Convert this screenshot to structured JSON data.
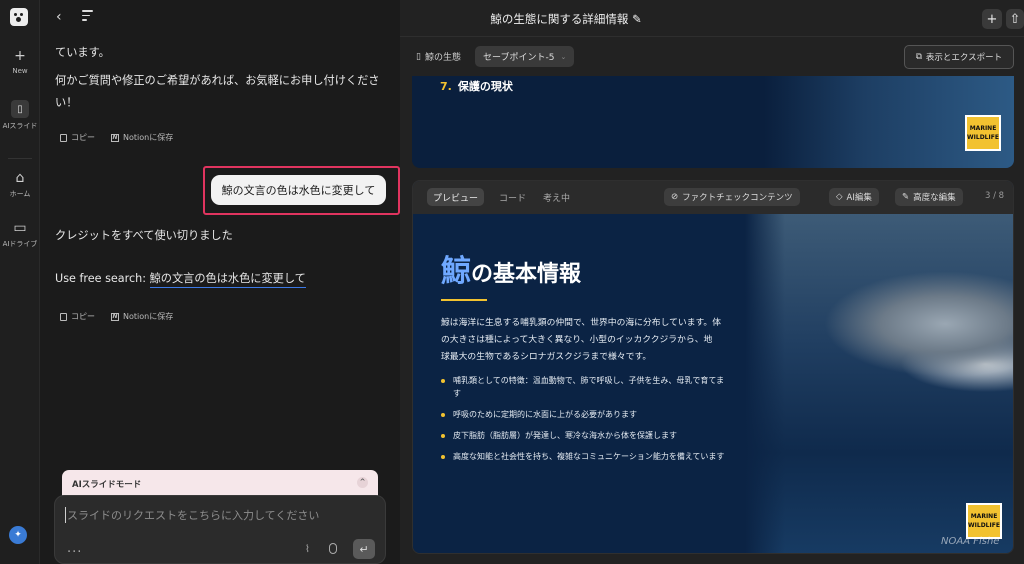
{
  "rail": {
    "items": [
      {
        "label": "New",
        "icon": "plus-icon"
      },
      {
        "label": "AIスライド",
        "icon": "slides-icon"
      },
      {
        "label": "ホーム",
        "icon": "home-icon"
      },
      {
        "label": "AIドライブ",
        "icon": "drive-icon"
      }
    ]
  },
  "chat": {
    "msg_top": "ています。",
    "msg_help_1": "何かご質問や修正のご希望があれば、お気軽にお申し付けくださ",
    "msg_help_2": "い！",
    "copy_label": "コピー",
    "notion_label": "Notionに保存",
    "user_message": "鯨の文言の色は水色に変更して",
    "credit_message": "クレジットをすべて使い切りました",
    "search_prefix": "Use free search: ",
    "search_query": "鯨の文言の色は水色に変更して",
    "mode_label": "AIスライドモード",
    "input_placeholder": "スライドのリクエストをこちらに入力してください",
    "more": "..."
  },
  "header": {
    "title": "鯨の生態に関する詳細情報",
    "deck_name": "鯨の生態",
    "save_point": "セーブポイント-5",
    "export_label": "表示とエクスポート"
  },
  "slide_prev": {
    "item_num": "7.",
    "item_text": "保護の現状",
    "badge_line1": "MARINE",
    "badge_line2": "WILDLIFE"
  },
  "card": {
    "tabs": [
      "プレビュー",
      "コード",
      "考え中"
    ],
    "factcheck_label": "ファクトチェックコンテンツ",
    "ai_edit_label": "AI編集",
    "advanced_edit_label": "高度な編集",
    "page_indicator": "3 / 8"
  },
  "slide": {
    "title_kanji": "鯨",
    "title_rest": "の基本情報",
    "intro": "鯨は海洋に生息する哺乳類の仲間で、世界中の海に分布しています。体の大きさは種によって大きく異なり、小型のイッカククジラから、地球最大の生物であるシロナガスクジラまで様々です。",
    "bullets": [
      "哺乳類としての特徴：温血動物で、肺で呼吸し、子供を生み、母乳で育てます",
      "呼吸のために定期的に水面に上がる必要があります",
      "皮下脂肪（脂肪層）が発達し、寒冷な海水から体を保護します",
      "高度な知能と社会性を持ち、複雑なコミュニケーション能力を備えています"
    ],
    "badge_line1": "MARINE",
    "badge_line2": "WILDLIFE",
    "credit": "NOAA Fishe"
  },
  "colors": {
    "highlight_border": "#e0345f",
    "accent_yellow": "#f2c230",
    "title_blue": "#6fa8ff",
    "slide_bg": "#0b2344"
  }
}
